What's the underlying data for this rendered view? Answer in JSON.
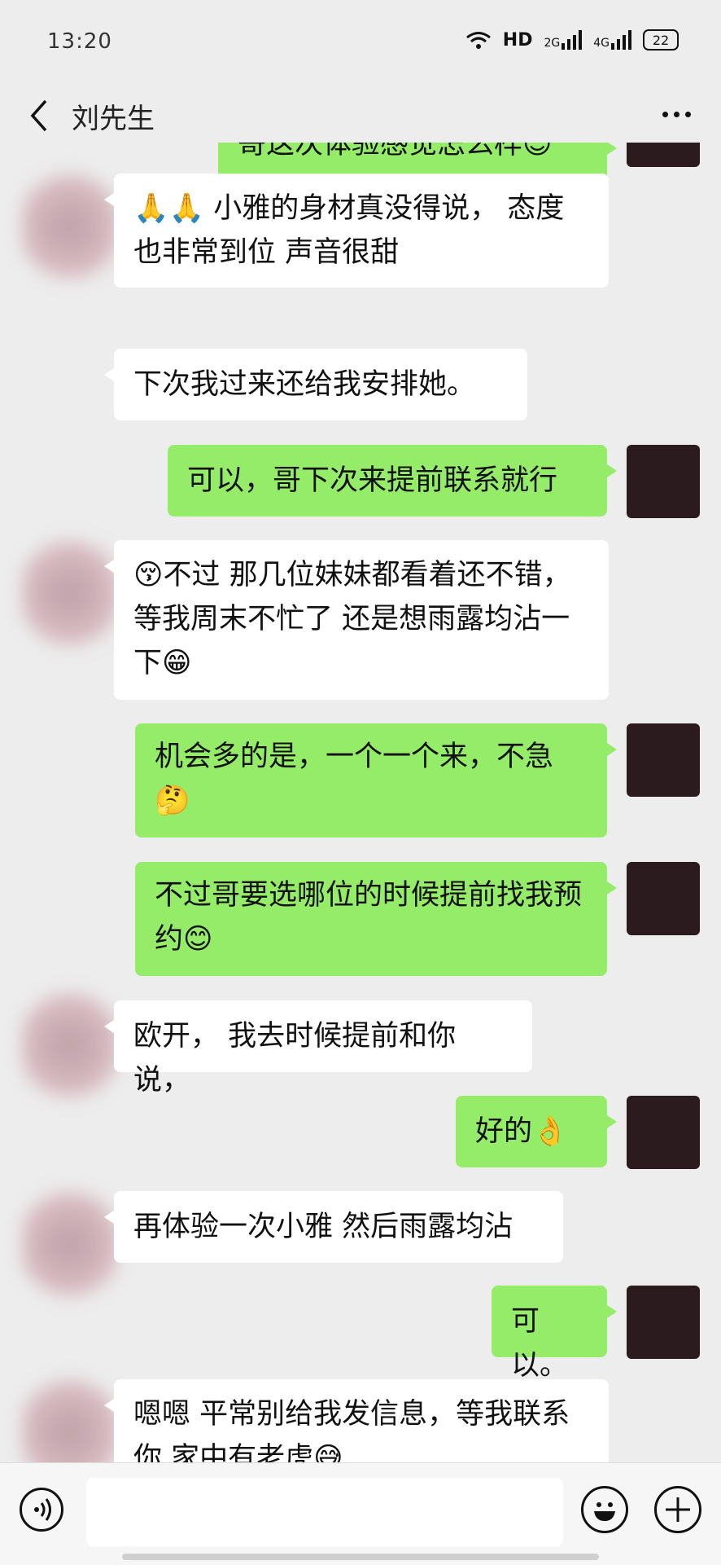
{
  "status": {
    "time": "13:20",
    "hd": "HD",
    "net1": "2G",
    "net2": "4G",
    "battery": "22"
  },
  "header": {
    "title": "刘先生"
  },
  "messages": [
    {
      "side": "right",
      "text": "哥这次体验感觉怎么样😊"
    },
    {
      "side": "left",
      "text": "🙏🙏 小雅的身材真没得说， 态度也非常到位 声音很甜"
    },
    {
      "side": "left",
      "text": "下次我过来还给我安排她。"
    },
    {
      "side": "right",
      "text": "可以，哥下次来提前联系就行"
    },
    {
      "side": "left",
      "text": "😚不过 那几位妹妹都看着还不错， 等我周末不忙了 还是想雨露均沾一下😁"
    },
    {
      "side": "right",
      "text": "机会多的是，一个一个来，不急🤔"
    },
    {
      "side": "right",
      "text": "不过哥要选哪位的时候提前找我预约😊"
    },
    {
      "side": "left",
      "text": "欧开， 我去时候提前和你说，"
    },
    {
      "side": "right",
      "text": "好的👌"
    },
    {
      "side": "left",
      "text": "再体验一次小雅 然后雨露均沾"
    },
    {
      "side": "right",
      "text": "可以。"
    },
    {
      "side": "left",
      "text": "嗯嗯 平常别给我发信息，等我联系你 家中有老虎😅"
    }
  ],
  "icons": {
    "back": "back-arrow-icon",
    "more": "more-icon",
    "voice": "voice-icon",
    "emoji": "emoji-icon",
    "plus": "plus-icon"
  },
  "colors": {
    "sent_bubble": "#95ec69",
    "received_bubble": "#ffffff",
    "background": "#ededed"
  }
}
